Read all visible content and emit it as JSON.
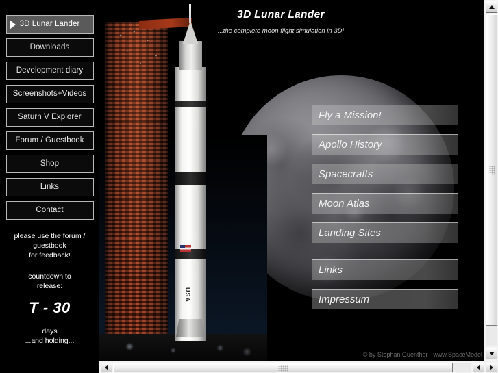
{
  "header": {
    "title": "3D Lunar Lander",
    "tagline": "...the complete moon flight simulation in 3D!"
  },
  "sidebar": {
    "items": [
      {
        "label": "3D Lunar Lander",
        "active": true
      },
      {
        "label": "Downloads",
        "active": false
      },
      {
        "label": "Development diary",
        "active": false
      },
      {
        "label": "Screenshots+Videos",
        "active": false
      },
      {
        "label": "Saturn V Explorer",
        "active": false
      },
      {
        "label": "Forum / Guestbook",
        "active": false
      },
      {
        "label": "Shop",
        "active": false
      },
      {
        "label": "Links",
        "active": false
      },
      {
        "label": "Contact",
        "active": false
      }
    ],
    "feedback_note": {
      "line1": "please use the forum /",
      "line2": "guestbook",
      "line3": "for feedback!"
    },
    "countdown": {
      "label_line1": "countdown to",
      "label_line2": "release:",
      "value": "T - 30",
      "units": "days",
      "status": "...and holding..."
    }
  },
  "moon_menu": {
    "items": [
      {
        "label": "Fly a Mission!"
      },
      {
        "label": "Apollo History"
      },
      {
        "label": "Spacecrafts"
      },
      {
        "label": "Moon Atlas"
      },
      {
        "label": "Landing Sites"
      },
      {
        "label": "Links"
      },
      {
        "label": "Impressum"
      }
    ]
  },
  "rocket": {
    "usa_marking": "USA"
  },
  "footer": {
    "copyright": "© by Stephan Guenther - www.SpaceModel"
  },
  "colors": {
    "background": "#000000",
    "button_border": "#b9b9b9",
    "active_button": "#5a5a5a",
    "tower_red": "#a8391a",
    "scrollbar_face": "#f3f3f3"
  }
}
